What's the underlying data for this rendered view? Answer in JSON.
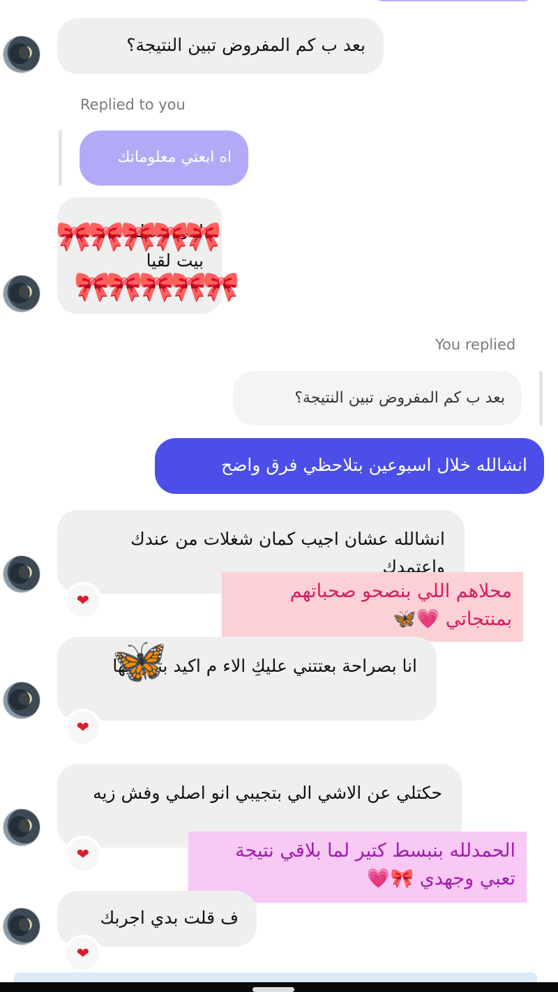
{
  "messages": {
    "m1": "بعد ب كم المفروض تبين النتيجة؟",
    "replied_to_you": "Replied to you",
    "quote_purple": "اه ابعتي معلوماتك",
    "m_hidden_line1": "امي وخالة",
    "m_hidden_line2": "بيت لقيا",
    "you_replied": "You replied",
    "quote_gray": "بعد ب كم المفروض تبين النتيجة؟",
    "sent": "انشالله خلال اسبوعين بتلاحظي فرق واضح",
    "m3": "انشالله عشان اجيب كمان شغلات من عندك واعتمدك",
    "m4": "انا بصراحة بعتتني عليكِ الاء م اكيد بتعرفيها",
    "m5": "حكتلي عن الاشي الي بتجيبي انو اصلي وفش زيه",
    "m6": "ف قلت بدي اجربك"
  },
  "stickers": {
    "s1": "محلاهم اللي بنصحو صحباتهم بمنتجاتي 💗🦋",
    "s2": "الحمدلله بنبسط كتير لما بلاقي نتيجة تعبي وجهدي 🎀💗"
  },
  "reactions": {
    "heart": "❤"
  },
  "decor": {
    "bows_row": "🎀🎀🎀🎀🎀",
    "butterfly": "🦋"
  },
  "colors": {
    "sent_bubble": "#4b4ee8",
    "received_bubble": "#efefef",
    "quote_purple": "#b2aaf7",
    "sticker_pink": "#fbd1d6",
    "sticker_pink_text": "#d81b60",
    "sticker_violet": "#f7c9f4",
    "sticker_violet_text": "#a21caf"
  }
}
